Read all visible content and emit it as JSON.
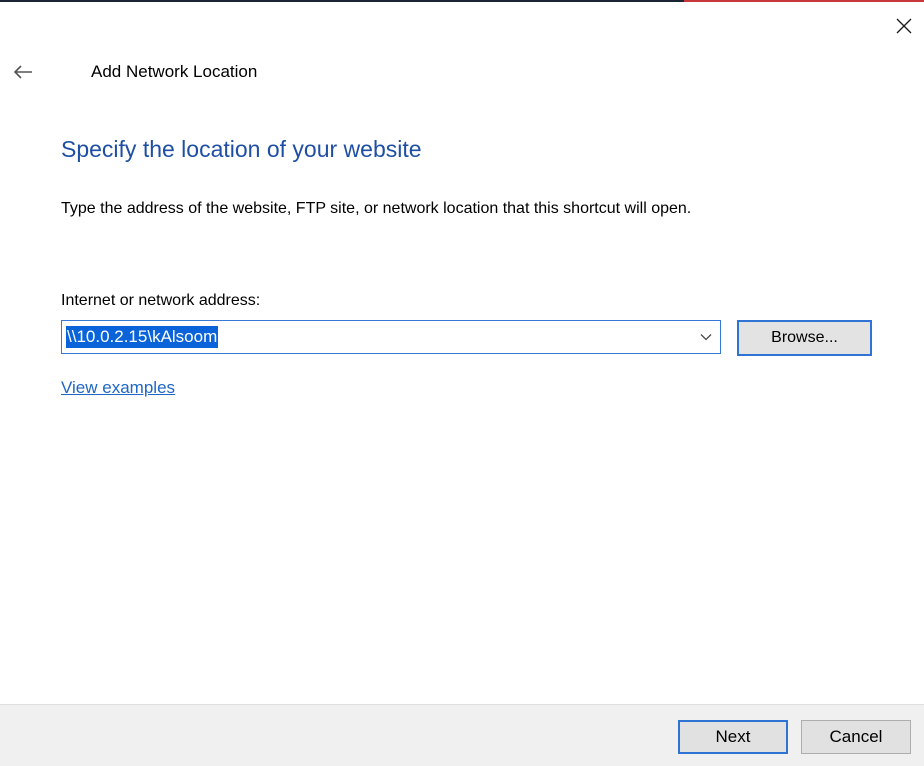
{
  "window": {
    "title": "Add Network Location",
    "close_icon": "close-icon",
    "back_icon": "back-arrow-icon"
  },
  "content": {
    "heading": "Specify the location of your website",
    "instruction": "Type the address of the website, FTP site, or network location that this shortcut will open.",
    "address_label": "Internet or network address:",
    "address_value": "\\\\10.0.2.15\\kAlsoom",
    "dropdown_icon": "chevron-down-icon",
    "browse_label": "Browse...",
    "view_examples_link": "View examples"
  },
  "footer": {
    "next_label": "Next",
    "cancel_label": "Cancel"
  },
  "colors": {
    "heading": "#1f4fa5",
    "link": "#1f66c6",
    "selection": "#0a63d8",
    "focus_border": "#2f73d4",
    "footer_bg": "#f0f0f0",
    "button_bg": "#e1e1e1"
  }
}
